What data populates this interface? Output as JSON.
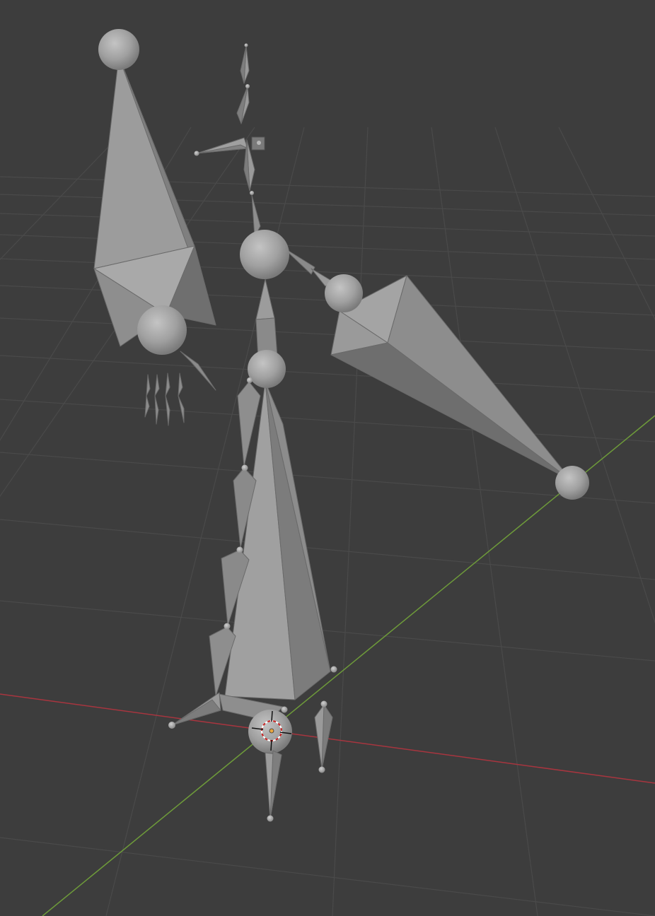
{
  "viewport": {
    "kind": "3d-viewport",
    "object": "armature",
    "display": "octahedral-bones",
    "background_color": "#3d3d3d",
    "grid_color": "#4a4a4a",
    "x_axis_color": "#a8353f",
    "y_axis_color": "#6e9b3a",
    "bone_color": "#9a9a9a",
    "cursor_icon": "3d-cursor-icon"
  }
}
